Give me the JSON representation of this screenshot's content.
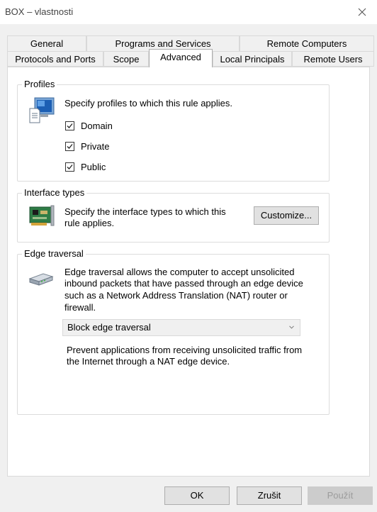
{
  "window": {
    "title": "BOX – vlastnosti"
  },
  "tabs_row1": [
    "General",
    "Programs and Services",
    "Remote Computers"
  ],
  "tabs_row2": [
    "Protocols and Ports",
    "Scope",
    "Advanced",
    "Local Principals",
    "Remote Users"
  ],
  "profiles": {
    "legend": "Profiles",
    "description": "Specify profiles to which this rule applies.",
    "items": [
      {
        "label": "Domain",
        "checked": true
      },
      {
        "label": "Private",
        "checked": true
      },
      {
        "label": "Public",
        "checked": true
      }
    ]
  },
  "interface": {
    "legend": "Interface types",
    "description_line1": "Specify the interface types to which this",
    "description_line2": "rule applies.",
    "button": "Customize..."
  },
  "edge": {
    "legend": "Edge traversal",
    "description_lines": [
      "Edge traversal allows the computer to accept unsolicited",
      "inbound packets that have passed through an edge device",
      "such as a Network Address Translation (NAT) router or",
      "firewall."
    ],
    "select_value": "Block edge traversal",
    "help_lines": [
      "Prevent applications from receiving unsolicited traffic from",
      "the Internet through a NAT edge device."
    ]
  },
  "buttons": {
    "ok": "OK",
    "cancel": "Zrušit",
    "apply": "Použít"
  }
}
